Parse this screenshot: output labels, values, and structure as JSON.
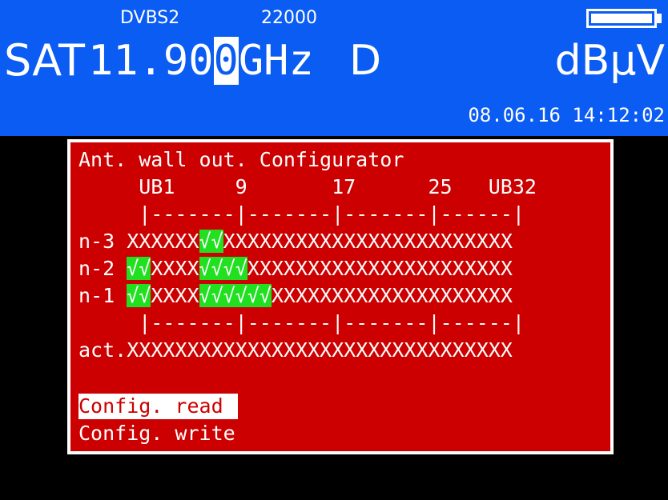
{
  "header": {
    "modulation": "DVBS2",
    "symbol_rate": "22000",
    "band": "SAT",
    "freq_before": "11.90",
    "freq_cursor": "0",
    "freq_after": "GHz",
    "polarization": "D",
    "unit": "dBµV",
    "datetime": "08.06.16 14:12:02",
    "battery_level": 1.0
  },
  "panel": {
    "title": "Ant. wall out. Configurator",
    "column_header": "     UB1     9       17      25   UB32",
    "ruler": "     |-------|-------|-------|------|",
    "rows": [
      {
        "label": "n-3 ",
        "pre": "XXXXXX",
        "green": "√√",
        "post": "XXXXXXXXXXXXXXXXXXXXXXXX"
      },
      {
        "label": "n-2 ",
        "pre": "",
        "green": "√√",
        "mid": "XXXX",
        "green2": "√√√√",
        "post": "XXXXXXXXXXXXXXXXXXXXXX"
      },
      {
        "label": "n-1 ",
        "pre": "",
        "green": "√√",
        "mid": "XXXX",
        "green2": "√√√√√√",
        "post": "XXXXXXXXXXXXXXXXXXXX"
      }
    ],
    "act_label": "act.",
    "act_values": "XXXXXXXXXXXXXXXXXXXXXXXXXXXXXXXX",
    "menu": {
      "read": "Config. read",
      "write": "Config. write"
    }
  },
  "colors": {
    "header_bg": "#0a5cf2",
    "panel_bg": "#cc0000",
    "active_slot": "#20e020",
    "text": "#ffffff"
  }
}
